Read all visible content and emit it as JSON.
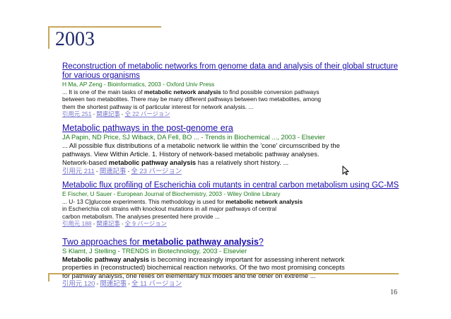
{
  "slide": {
    "title": "2003",
    "page_number": "16"
  },
  "results": [
    {
      "title_pre": "Reconstruction of metabolic networks from genome data and analysis of their global structure for various organisms",
      "title_bold": "",
      "title_post": "",
      "source": "H Ma, AP Zeng - Bioinformatics, 2003 - Oxford Univ Press",
      "snippet": [
        [
          "... It is one of the main tasks of ",
          "metabolic network analysis",
          " to find possible conversion pathways"
        ],
        [
          "between two metabolites. There may be many different pathways between two metabolites, among",
          "",
          ""
        ],
        [
          "them the shortest pathway is of particular interest for network analysis. ...",
          "",
          ""
        ]
      ],
      "cited": "引用元 251",
      "related": "関連記事",
      "versions": "全 22 バージョン"
    },
    {
      "title_pre": "Metabolic pathways in the post-genome era",
      "title_bold": "",
      "title_post": "",
      "source": "JA Papin, ND Price, SJ Wiback, DA Fell, BO ... - Trends in Biochemical ..., 2003 - Elsevier",
      "snippet": [
        [
          "... All possible flux distributions of a metabolic network lie within the 'cone' circumscribed by the",
          "",
          ""
        ],
        [
          "pathways. View Within Article. 1. History of network-based metabolic pathway analyses.",
          "",
          ""
        ],
        [
          "Network-based ",
          "metabolic pathway analysis",
          " has a relatively short history. ..."
        ]
      ],
      "cited": "引用元 211",
      "related": "関連記事",
      "versions": "全 23 バージョン"
    },
    {
      "title_pre": "Metabolic flux profiling of Escherichia coli mutants in central carbon metabolism using GC-MS",
      "title_bold": "",
      "title_post": "",
      "source": "E Fischer, U Sauer - European Journal of Biochemistry, 2003 - Wiley Online Library",
      "snippet": [
        [
          "... U- 13 C]glucose experiments. This methodology is used for ",
          "metabolic network analysis",
          ""
        ],
        [
          "in Escherichia coli strains with knockout mutations in all major pathways of central",
          "",
          ""
        ],
        [
          "carbon metabolism. The analyses presented here provide ...",
          "",
          ""
        ]
      ],
      "cited": "引用元 188",
      "related": "関連記事",
      "versions": "全 9 バージョン"
    },
    {
      "title_pre": "Two approaches for ",
      "title_bold": "metabolic pathway analysis",
      "title_post": "?",
      "source": "S Klamt, J Stelling - TRENDS in Biotechnology, 2003 - Elsevier",
      "snippet": [
        [
          "",
          "Metabolic pathway analysis",
          " is becoming increasingly important for assessing inherent network"
        ],
        [
          "properties in (reconstructed) biochemical reaction networks. Of the two most promising concepts",
          "",
          ""
        ],
        [
          "for pathway analysis, one relies on elementary flux modes and the other on extreme ...",
          "",
          ""
        ]
      ],
      "cited": "引用元 120",
      "related": "関連記事",
      "versions": "全 11 バージョン"
    }
  ],
  "colors": {
    "title_link": "#1a0dab",
    "source_green": "#1a7a1a",
    "footer_link": "#7777cc",
    "accent_gold": "#c8a85a",
    "slide_title": "#1f2a6b"
  },
  "icons": {
    "cursor": "mouse-pointer-icon"
  }
}
